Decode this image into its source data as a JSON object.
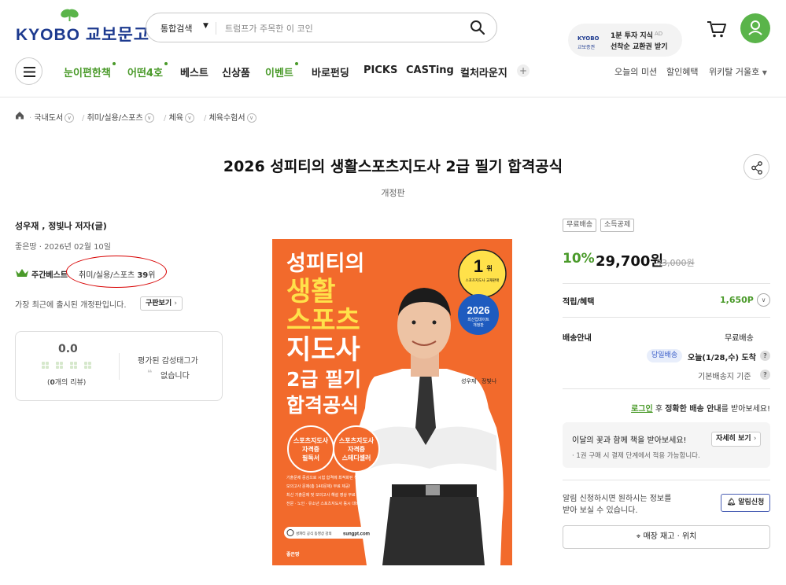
{
  "header": {
    "logo_text": "KYOBO 교보문고",
    "search": {
      "category": "통합검색",
      "placeholder": "트럼프가 주목한 이 코인"
    },
    "ad": {
      "logo": "KYOBO",
      "logo_sub": "교보증권",
      "line1": "1분 투자 지식",
      "tag": "AD",
      "line2": "선착순 교환권 받기"
    }
  },
  "nav": {
    "items": [
      {
        "label": "눈이편한책",
        "highlight": true,
        "dot": true
      },
      {
        "label": "어떤4호",
        "highlight": true,
        "dot": true
      },
      {
        "label": "베스트",
        "highlight": false,
        "dot": false
      },
      {
        "label": "신상품",
        "highlight": false,
        "dot": false
      },
      {
        "label": "이벤트",
        "highlight": true,
        "dot": true
      },
      {
        "label": "바로펀딩",
        "highlight": false,
        "dot": false
      },
      {
        "label": "PICKS",
        "highlight": false,
        "dot": false
      },
      {
        "label": "CASTing",
        "highlight": false,
        "dot": false
      },
      {
        "label": "컬처라운지",
        "highlight": false,
        "dot": false
      }
    ],
    "plus": "+",
    "right": [
      "오늘의 미션",
      "할인혜택",
      "위키탈 거울호"
    ]
  },
  "breadcrumb": [
    "국내도서",
    "취미/실용/스포츠",
    "체육",
    "체육수험서"
  ],
  "product": {
    "title": "2026 성피티의 생활스포츠지도사 2급 필기 합격공식",
    "edition": "개정판",
    "author": "성우재 , 정빛나 저자(글)",
    "publisher_date": "좋은땅 · 2026년 02월 10일",
    "bestseller_label": "주간베스트",
    "bestseller_category": "취미/실용/스포츠",
    "bestseller_rank": "39",
    "bestseller_rank_suffix": "위",
    "note": "가장 최근에 출시된 개정판입니다.",
    "old_edition_btn": "구판보기",
    "review": {
      "score": "0.0",
      "count_prefix": "(",
      "count": "0",
      "count_suffix": "개의 리뷰)",
      "emotion_line1": "평가된 감성태그가",
      "emotion_line2": "없습니다"
    }
  },
  "cover": {
    "line1": "성피티의",
    "line2": "생활",
    "line3": "스포츠",
    "line4": "지도사",
    "line5": "2급 필기",
    "line6": "합격공식",
    "badge_rank": "1",
    "badge_rank_suffix": "위",
    "badge_sub": "스포츠지도사 교재판매",
    "badge_year": "2026",
    "badge_year_sub1": "최신업데이트",
    "badge_year_sub2": "개정판",
    "authors": "성우재 · 정빛나",
    "pill1_a": "스포츠지도사",
    "pill1_b": "자격증",
    "pill1_c": "필독서",
    "pill2_a": "스포츠지도사",
    "pill2_b": "자격증",
    "pill2_c": "스테디셀러",
    "bullets": [
      "기출문제 중심으로 시험 합격에 최적화된 책",
      "모의고사 문제(총 140문제) 무료 제공!",
      "최신 기출문제 및 모의고사 해설 영상 무료 제공!",
      "전문 · 노인 · 유소년 스포츠지도사 동시 대비"
    ],
    "site_label": "성피티 공식 동영상 강의",
    "site_url": "sungpt.com",
    "publisher": "좋은땅"
  },
  "purchase": {
    "tags": [
      "무료배송",
      "소득공제"
    ],
    "discount": "10%",
    "price": "29,700원",
    "original_price": "33,000원",
    "points_label": "적립/혜택",
    "points_value": "1,650P",
    "shipping_label": "배송안내",
    "shipping_value": "무료배송",
    "sameday_badge": "당일배송",
    "arrival": "오늘(1/28,수) 도착",
    "standard_text": "기본배송지 기준",
    "login_link": "로그인",
    "login_text_1": " 후 ",
    "login_text_bold": "정확한 배송 안내",
    "login_text_2": "를 받아보세요!",
    "promo_title": "이달의 꽃과 함께 책을 받아보세요!",
    "promo_sub": "· 1권 구매 시 결제 단계에서 적용 가능합니다.",
    "promo_btn": "자세히 보기",
    "alarm_text1": "알림 신청하시면 원하시는 정보를",
    "alarm_text2": "받아 보실 수 있습니다.",
    "alarm_btn": "알림신청",
    "store_btn": "매장 재고 · 위치"
  },
  "colors": {
    "brand": "#1d3a8f",
    "accent_green": "#4a9a2a",
    "cover_orange": "#f26a2c",
    "cover_yellow": "#ffe14a",
    "annotation_red": "#d80000"
  }
}
